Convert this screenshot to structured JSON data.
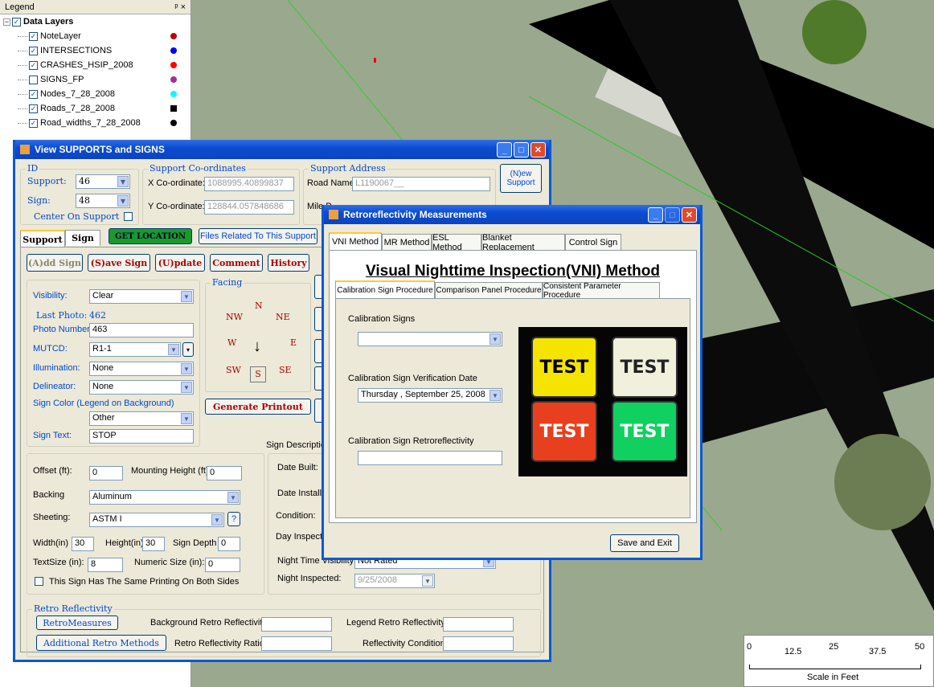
{
  "legend": {
    "title": "Legend",
    "pin": "q ×",
    "group": "Data Layers",
    "layers": [
      {
        "name": "NoteLayer",
        "checked": true,
        "color": "#c00000"
      },
      {
        "name": "INTERSECTIONS",
        "checked": true,
        "color": "#0000ff"
      },
      {
        "name": "CRASHES_HSIP_2008",
        "checked": true,
        "color": "#ff0000"
      },
      {
        "name": "SIGNS_FP",
        "checked": false,
        "color": "#993399"
      },
      {
        "name": "Nodes_7_28_2008",
        "checked": true,
        "color": "#00ffff"
      },
      {
        "name": "Roads_7_28_2008",
        "checked": true,
        "color": "#000000"
      },
      {
        "name": "Road_widths_7_28_2008",
        "checked": true,
        "color": "#000000"
      }
    ]
  },
  "supports": {
    "title": "View SUPPORTS and SIGNS",
    "id": {
      "group": "ID",
      "support_label": "Support:",
      "support": "46",
      "sign_label": "Sign:",
      "sign": "48",
      "center_label": "Center On Support"
    },
    "coords": {
      "group": "Support Co-ordinates",
      "x_label": "X Co-ordinate:",
      "x": "1088995.40899837",
      "y_label": "Y Co-ordinate:",
      "y": "128844.057848686"
    },
    "address": {
      "group": "Support Address",
      "road_label": "Road Name",
      "road": "L1190067__",
      "mile_label": "Mile P"
    },
    "new_support": "(N)ew Support",
    "tabs": [
      "Support",
      "Sign"
    ],
    "get_location": "GET LOCATION",
    "files_btn": "Files Related To This Support",
    "actions": [
      "(A)dd Sign",
      "(S)ave Sign",
      "(U)pdate",
      "Comment",
      "History"
    ],
    "visibility_label": "Visibility:",
    "visibility": "Clear",
    "last_photo_label": "Last Photo:",
    "last_photo": "462",
    "photo_number_label": "Photo Number",
    "photo_number": "463",
    "mutcd_label": "MUTCD:",
    "mutcd": "R1-1",
    "illum_label": "Illumination:",
    "illum": "None",
    "delin_label": "Delineator:",
    "delin": "None",
    "color_label": "Sign Color (Legend on Background)",
    "color": "Other",
    "text_label": "Sign Text:",
    "text": "STOP",
    "facing_label": "Facing",
    "facing": {
      "N": "N",
      "NW": "NW",
      "NE": "NE",
      "W": "W",
      "E": "E",
      "SW": "SW",
      "SE": "SE",
      "S": "S"
    },
    "printout": "Generate Printout",
    "desc_label": "Sign Description",
    "offset_label": "Offset (ft):",
    "offset": "0",
    "mount_label": "Mounting Height (ft):",
    "mount": "0",
    "backing_label": "Backing",
    "backing": "Aluminum",
    "sheeting_label": "Sheeting:",
    "sheeting": "ASTM I",
    "help": "?",
    "width_label": "Width(in)",
    "width": "30",
    "height_label": "Height(in)",
    "height": "30",
    "depth_label": "Sign Depth",
    "depth": "0",
    "textsize_label": "TextSize (in):",
    "textsize": "8",
    "numsize_label": "Numeric Size (in):",
    "numsize": "0",
    "same_print": "This Sign Has The Same Printing On Both Sides",
    "date_built": "Date Built:",
    "date_installed": "Date Installed",
    "condition": "Condition:",
    "day_inspected": "Day Inspected",
    "night_vis_label": "Night Time Visibility:",
    "night_vis": "Not Rated",
    "night_insp_label": "Night Inspected:",
    "night_insp": "9/25/2008",
    "retro_group": "Retro Reflectivity",
    "retro_btn": "RetroMeasures",
    "add_retro_btn": "Additional Retro Methods",
    "bg_retro": "Background Retro Reflectivity",
    "legend_retro": "Legend Retro Reflectivity",
    "ratio": "Retro Reflectivity Ratio",
    "refl_cond": "Reflectivity Condition"
  },
  "retro": {
    "title": "Retroreflectivity Measurements",
    "tabs": [
      "VNI Method",
      "MR Method",
      "ESL Method",
      "Blanket Replacement",
      "Control Sign"
    ],
    "heading": "Visual Nighttime Inspection(VNI) Method",
    "subtabs": [
      "Calibration Sign Procedure",
      "Comparison Panel Procedure",
      "Consistent Parameter Procedure"
    ],
    "cal_signs": "Calibration Signs",
    "cal_date_label": "Calibration Sign Verification Date",
    "cal_date": "Thursday   , September 25, 2008",
    "cal_retro": "Calibration Sign Retroreflectivity",
    "save": "Save and Exit",
    "signs": [
      {
        "text": "TEST",
        "bg": "#f5e400",
        "fg": "#000"
      },
      {
        "text": "TEST",
        "bg": "#f0f0dc",
        "fg": "#222"
      },
      {
        "text": "TEST",
        "bg": "#e8401f",
        "fg": "#fff"
      },
      {
        "text": "TEST",
        "bg": "#10d060",
        "fg": "#fff"
      }
    ]
  },
  "scale": {
    "ticks": [
      "0",
      "12.5",
      "25",
      "37.5",
      "50"
    ],
    "label": "Scale in Feet"
  }
}
